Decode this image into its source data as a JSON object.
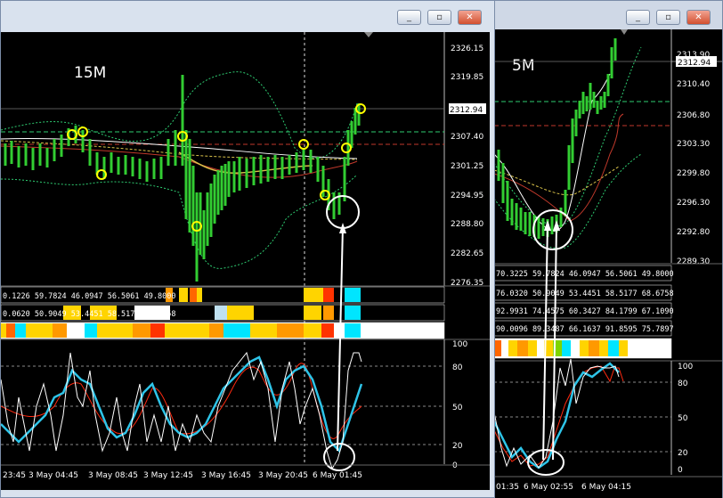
{
  "windows": [
    {
      "id": "w1",
      "timeframe_label": "15M",
      "buttons": {
        "minimize": "_",
        "restore": "▫",
        "close": "✕"
      },
      "price_axis": [
        "2326.15",
        "2319.85",
        "2313.55",
        "2307.40",
        "2301.25",
        "2294.95",
        "2288.80",
        "2282.65",
        "2276.35"
      ],
      "current_price": "2312.94",
      "indicator_rows": [
        "0.1226 59.7824 46.0947 56.5061 49.8000",
        "0.0620 50.9049 53.4451 58.5177 68.6758",
        ""
      ],
      "oscillator_axis": [
        "100",
        "80",
        "50",
        "20",
        "0"
      ],
      "time_axis": [
        "23:45",
        "3 May 04:45",
        "3 May 08:45",
        "3 May 12:45",
        "3 May 16:45",
        "3 May 20:45",
        "6 May 01:45"
      ]
    },
    {
      "id": "w2",
      "timeframe_label": "5M",
      "buttons": {
        "minimize": "_",
        "restore": "▫",
        "close": "✕"
      },
      "price_axis": [
        "2313.90",
        "2310.40",
        "2306.80",
        "2303.30",
        "2299.80",
        "2296.30",
        "2292.80",
        "2289.30"
      ],
      "current_price": "2312.94",
      "indicator_rows": [
        "70.3225 59.7824 46.0947 56.5061 49.8000",
        "76.0320 50.9049 53.4451 58.5177 68.6758",
        "92.9931 74.4575 60.3427 84.1799 67.1090",
        "90.0096 89.3487 66.1637 91.8595 75.7897"
      ],
      "oscillator_axis": [
        "100",
        "80",
        "50",
        "20",
        "0"
      ],
      "time_axis": [
        "01:35",
        "6 May 02:55",
        "6 May 04:15"
      ]
    }
  ],
  "colors": {
    "price_line": "#ffffff",
    "bollinger": "#2ecc71",
    "ma_fast": "#d9c24a",
    "ma_slow": "#c0392b",
    "circle": "#ffff00",
    "stoch_main": "#ffffff",
    "stoch_signal": "#ff2a10",
    "stoch_highlight": "#2ec4e8",
    "candles": "#32cd32"
  }
}
